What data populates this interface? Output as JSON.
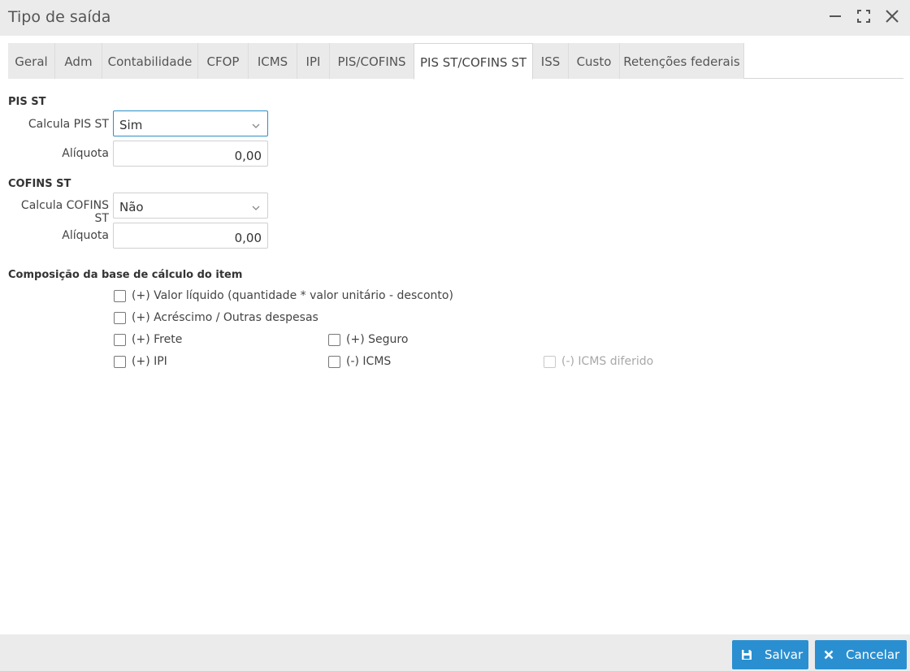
{
  "window": {
    "title": "Tipo de saída"
  },
  "tabs": [
    {
      "label": "Geral"
    },
    {
      "label": "Adm"
    },
    {
      "label": "Contabilidade"
    },
    {
      "label": "CFOP"
    },
    {
      "label": "ICMS"
    },
    {
      "label": "IPI"
    },
    {
      "label": "PIS/COFINS"
    },
    {
      "label": "PIS ST/COFINS ST",
      "active": true
    },
    {
      "label": "ISS"
    },
    {
      "label": "Custo"
    },
    {
      "label": "Retenções federais"
    }
  ],
  "pis_st": {
    "section": "PIS ST",
    "calcula_label": "Calcula PIS ST",
    "calcula_value": "Sim",
    "aliquota_label": "Alíquota",
    "aliquota_value": "0,00"
  },
  "cofins_st": {
    "section": "COFINS ST",
    "calcula_label": "Calcula COFINS ST",
    "calcula_value": "Não",
    "aliquota_label": "Alíquota",
    "aliquota_value": "0,00"
  },
  "composicao": {
    "section": "Composição da base de cálculo do item",
    "items": [
      {
        "label": "(+) Valor líquido (quantidade * valor unitário - desconto)",
        "checked": false
      },
      {
        "label": "(+) Acréscimo / Outras despesas",
        "checked": false
      },
      {
        "label": "(+) Frete",
        "checked": false
      },
      {
        "label": "(+) Seguro",
        "checked": false
      },
      {
        "label": "(+) IPI",
        "checked": false
      },
      {
        "label": "(-) ICMS",
        "checked": false
      },
      {
        "label": "(-) ICMS diferido",
        "checked": false,
        "disabled": true
      }
    ]
  },
  "footer": {
    "save_label": "Salvar",
    "cancel_label": "Cancelar"
  },
  "colors": {
    "accent": "#2a8fd0",
    "titlebar": "#ebebeb"
  }
}
